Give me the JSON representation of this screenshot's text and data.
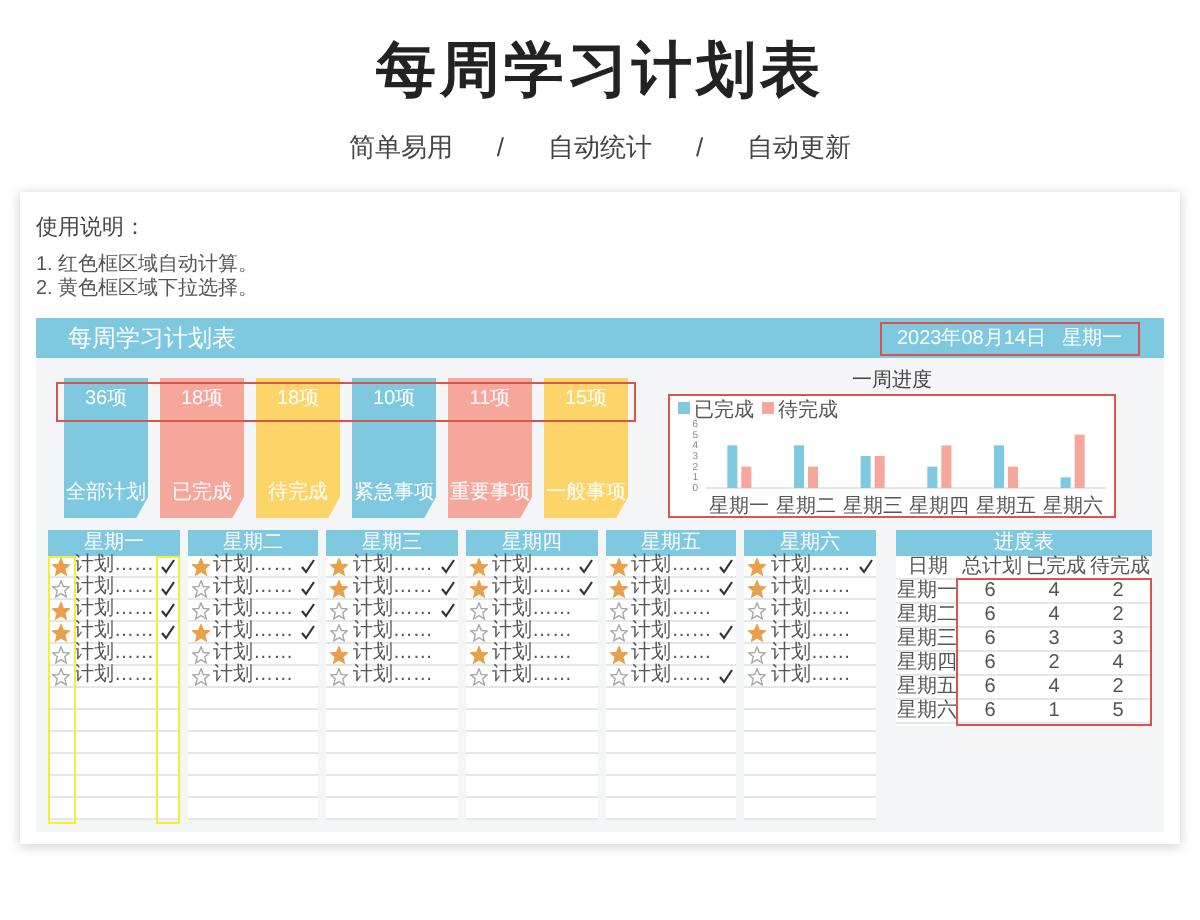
{
  "page": {
    "title": "每周学习计划表",
    "features": [
      "简单易用",
      "自动统计",
      "自动更新"
    ],
    "separator": "/"
  },
  "instructions": {
    "heading": "使用说明：",
    "lines": [
      "1. 红色框区域自动计算。",
      "2. 黄色框区域下拉选择。"
    ]
  },
  "sheet": {
    "title": "每周学习计划表",
    "date": "2023年08月14日",
    "weekday": "星期一",
    "stats": [
      {
        "value": "36项",
        "label": "全部计划",
        "color": "#7ec8e0"
      },
      {
        "value": "18项",
        "label": "已完成",
        "color": "#f6a79c"
      },
      {
        "value": "18项",
        "label": "待完成",
        "color": "#fdd468"
      },
      {
        "value": "10项",
        "label": "紧急事项",
        "color": "#7ec8e0"
      },
      {
        "value": "11项",
        "label": "重要事项",
        "color": "#f6a79c"
      },
      {
        "value": "15项",
        "label": "一般事项",
        "color": "#fdd468"
      }
    ],
    "chart": {
      "title": "一周进度",
      "chart_data": {
        "type": "bar",
        "categories": [
          "星期一",
          "星期二",
          "星期三",
          "星期四",
          "星期五",
          "星期六"
        ],
        "series": [
          {
            "name": "已完成",
            "color": "#7ec8e0",
            "values": [
              4,
              4,
              3,
              2,
              4,
              1
            ]
          },
          {
            "name": "待完成",
            "color": "#f6a79c",
            "values": [
              2,
              2,
              3,
              4,
              2,
              5
            ]
          }
        ],
        "ylim": [
          0,
          6
        ],
        "yticks": [
          0,
          1,
          2,
          3,
          4,
          5,
          6
        ],
        "legend": "top-left"
      }
    },
    "days": [
      {
        "name": "星期一",
        "marked": true,
        "tasks": [
          {
            "text": "计划……",
            "starred": true,
            "done": true
          },
          {
            "text": "计划……",
            "starred": false,
            "done": true
          },
          {
            "text": "计划……",
            "starred": true,
            "done": true
          },
          {
            "text": "计划……",
            "starred": true,
            "done": true
          },
          {
            "text": "计划……",
            "starred": false,
            "done": false
          },
          {
            "text": "计划……",
            "starred": false,
            "done": false
          }
        ]
      },
      {
        "name": "星期二",
        "marked": false,
        "tasks": [
          {
            "text": "计划……",
            "starred": true,
            "done": true
          },
          {
            "text": "计划……",
            "starred": false,
            "done": true
          },
          {
            "text": "计划……",
            "starred": false,
            "done": true
          },
          {
            "text": "计划……",
            "starred": true,
            "done": true
          },
          {
            "text": "计划……",
            "starred": false,
            "done": false
          },
          {
            "text": "计划……",
            "starred": false,
            "done": false
          }
        ]
      },
      {
        "name": "星期三",
        "marked": false,
        "tasks": [
          {
            "text": "计划……",
            "starred": true,
            "done": true
          },
          {
            "text": "计划……",
            "starred": true,
            "done": true
          },
          {
            "text": "计划……",
            "starred": false,
            "done": true
          },
          {
            "text": "计划……",
            "starred": false,
            "done": false
          },
          {
            "text": "计划……",
            "starred": true,
            "done": false
          },
          {
            "text": "计划……",
            "starred": false,
            "done": false
          }
        ]
      },
      {
        "name": "星期四",
        "marked": false,
        "tasks": [
          {
            "text": "计划……",
            "starred": true,
            "done": true
          },
          {
            "text": "计划……",
            "starred": true,
            "done": true
          },
          {
            "text": "计划……",
            "starred": false,
            "done": false
          },
          {
            "text": "计划……",
            "starred": false,
            "done": false
          },
          {
            "text": "计划……",
            "starred": true,
            "done": false
          },
          {
            "text": "计划……",
            "starred": false,
            "done": false
          }
        ]
      },
      {
        "name": "星期五",
        "marked": false,
        "tasks": [
          {
            "text": "计划……",
            "starred": true,
            "done": true
          },
          {
            "text": "计划……",
            "starred": true,
            "done": true
          },
          {
            "text": "计划……",
            "starred": false,
            "done": false
          },
          {
            "text": "计划……",
            "starred": false,
            "done": true
          },
          {
            "text": "计划……",
            "starred": true,
            "done": false
          },
          {
            "text": "计划……",
            "starred": false,
            "done": true
          }
        ]
      },
      {
        "name": "星期六",
        "marked": false,
        "tasks": [
          {
            "text": "计划……",
            "starred": true,
            "done": true
          },
          {
            "text": "计划……",
            "starred": true,
            "done": false
          },
          {
            "text": "计划……",
            "starred": false,
            "done": false
          },
          {
            "text": "计划……",
            "starred": true,
            "done": false
          },
          {
            "text": "计划……",
            "starred": false,
            "done": false
          },
          {
            "text": "计划……",
            "starred": false,
            "done": false
          }
        ]
      }
    ],
    "progress": {
      "title": "进度表",
      "columns": [
        "日期",
        "总计划",
        "已完成",
        "待完成"
      ],
      "rows": [
        [
          "星期一",
          "6",
          "4",
          "2"
        ],
        [
          "星期二",
          "6",
          "4",
          "2"
        ],
        [
          "星期三",
          "6",
          "3",
          "3"
        ],
        [
          "星期四",
          "6",
          "2",
          "4"
        ],
        [
          "星期五",
          "6",
          "4",
          "2"
        ],
        [
          "星期六",
          "6",
          "1",
          "5"
        ]
      ]
    }
  }
}
